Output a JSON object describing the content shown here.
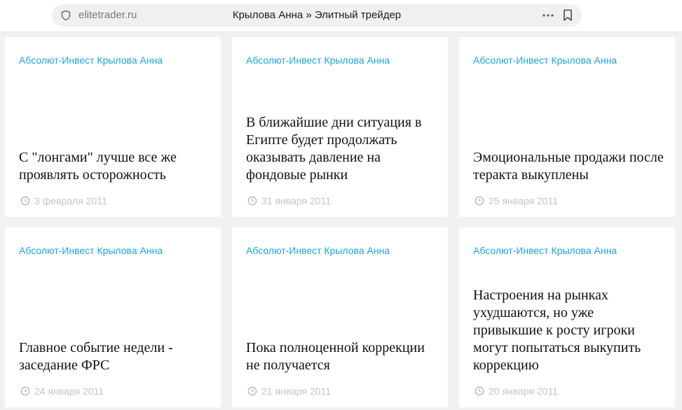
{
  "browser": {
    "domain": "elitetrader.ru",
    "title": "Крылова Анна » Элитный трейдер"
  },
  "colors": {
    "accent": "#1fa3d4",
    "date": "#c3c3c3",
    "background": "#f1f1f1"
  },
  "icons": {
    "site_info": "shield-icon",
    "more": "more-dots-icon",
    "bookmark": "bookmark-icon",
    "date": "clock-icon"
  },
  "articles": [
    {
      "source": "Абсолют-Инвест Крылова Анна",
      "title": "С \"лонгами\" лучше все же проявлять осторожность",
      "date": "3 февраля 2011"
    },
    {
      "source": "Абсолют-Инвест Крылова Анна",
      "title": "В ближайшие дни ситуация в Египте будет продолжать оказывать давление на фондовые рынки",
      "date": "31 января 2011"
    },
    {
      "source": "Абсолют-Инвест Крылова Анна",
      "title": "Эмоциональные продажи после теракта выкуплены",
      "date": "25 января 2011"
    },
    {
      "source": "Абсолют-Инвест Крылова Анна",
      "title": "Главное событие недели - заседание ФРС",
      "date": "24 января 2011"
    },
    {
      "source": "Абсолют-Инвест Крылова Анна",
      "title": "Пока полноценной коррекции не получается",
      "date": "21 января 2011"
    },
    {
      "source": "Абсолют-Инвест Крылова Анна",
      "title": "Настроения на рынках ухудшаются, но уже привыкшие к росту игроки могут попытаться выкупить коррекцию",
      "date": "20 января 2011"
    }
  ]
}
